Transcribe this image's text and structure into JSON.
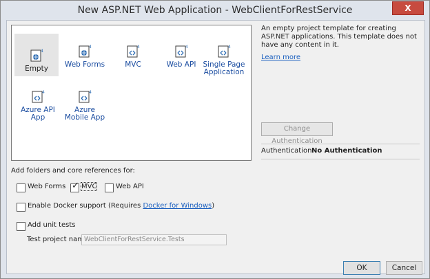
{
  "window": {
    "title": "New ASP.NET Web Application - WebClientForRestService",
    "close_glyph": "X"
  },
  "templates": [
    {
      "label": "Empty",
      "badge": "4",
      "icon": "web-template-icon",
      "selected": true
    },
    {
      "label": "Web Forms",
      "badge": "4",
      "icon": "web-forms-icon",
      "selected": false
    },
    {
      "label": "MVC",
      "badge": "4",
      "icon": "mvc-icon",
      "selected": false
    },
    {
      "label": "Web API",
      "badge": "4",
      "icon": "web-api-icon",
      "selected": false
    },
    {
      "label": "Single Page Application",
      "badge": "4",
      "icon": "spa-icon",
      "selected": false
    },
    {
      "label": "Azure API App",
      "badge": "4",
      "icon": "azure-api-app-icon",
      "selected": false
    },
    {
      "label": "Azure Mobile App",
      "badge": "4",
      "icon": "azure-mobile-app-icon",
      "selected": false
    }
  ],
  "description": {
    "text": "An empty project template for creating ASP.NET applications. This template does not have any content in it.",
    "learn_more": "Learn more"
  },
  "authentication": {
    "change_button": "Change Authentication",
    "label": "Authentication:",
    "value": "No Authentication"
  },
  "references": {
    "heading": "Add folders and core references for:",
    "options": [
      {
        "label": "Web Forms",
        "checked": false
      },
      {
        "label": "MVC",
        "checked": true
      },
      {
        "label": "Web API",
        "checked": false
      }
    ]
  },
  "docker": {
    "label": "Enable Docker support (Requires ",
    "link": "Docker for Windows",
    "suffix": ")",
    "checked": false
  },
  "unit_tests": {
    "label": "Add unit tests",
    "checked": false,
    "project_name_label": "Test project name:",
    "project_name_value": "WebClientForRestService.Tests"
  },
  "buttons": {
    "ok": "OK",
    "cancel": "Cancel"
  },
  "colors": {
    "accent": "#1a5fbf",
    "icon_blue": "#2e6db4",
    "close_red": "#c74b3f"
  }
}
